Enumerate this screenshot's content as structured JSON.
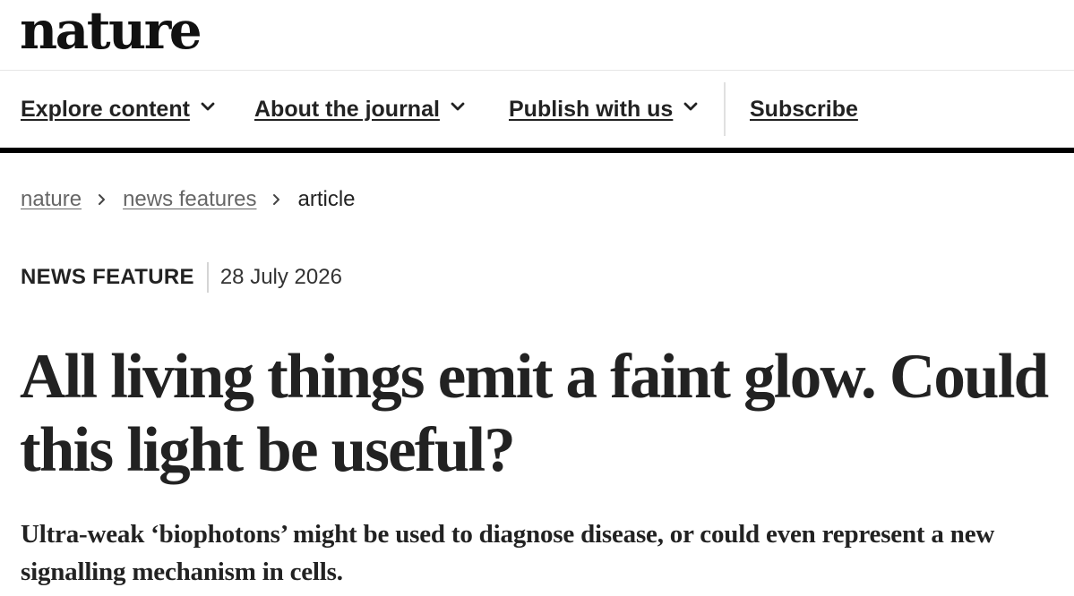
{
  "site": {
    "logo_text": "nature"
  },
  "nav": {
    "items": [
      {
        "label": "Explore content",
        "icon": "chevron-down-icon",
        "has_dropdown": true
      },
      {
        "label": "About the journal",
        "icon": "chevron-down-icon",
        "has_dropdown": true
      },
      {
        "label": "Publish with us",
        "icon": "chevron-down-icon",
        "has_dropdown": true
      },
      {
        "label": "Subscribe",
        "has_dropdown": false
      }
    ]
  },
  "breadcrumb": {
    "items": [
      "nature",
      "news features",
      "article"
    ],
    "separator_icon": "chevron-right-icon"
  },
  "article": {
    "type": "NEWS FEATURE",
    "date": "28 July 2026",
    "title": "All living things emit a faint glow. Could this light be useful?",
    "standfirst": "Ultra-weak ‘biophotons’ might be used to diagnose disease, or could even represent a new signalling mechanism in cells."
  },
  "colors": {
    "text": "#222222",
    "nav_rule": "#000000",
    "divider": "#e0e0e0",
    "muted_link": "#666666"
  }
}
